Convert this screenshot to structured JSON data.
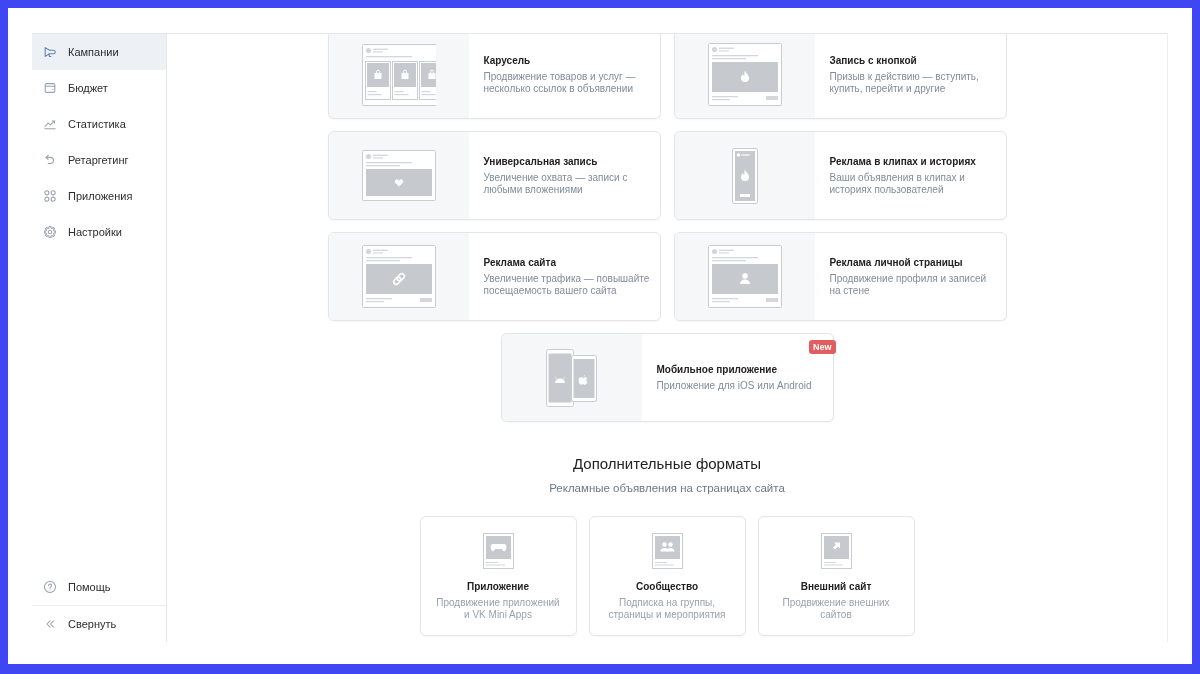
{
  "sidebar": {
    "items": [
      {
        "label": "Кампании",
        "selected": true
      },
      {
        "label": "Бюджет",
        "selected": false
      },
      {
        "label": "Статистика",
        "selected": false
      },
      {
        "label": "Ретаргетинг",
        "selected": false
      },
      {
        "label": "Приложения",
        "selected": false
      },
      {
        "label": "Настройки",
        "selected": false
      }
    ],
    "footer_items": [
      {
        "label": "Помощь"
      },
      {
        "label": "Свернуть"
      }
    ]
  },
  "formats": [
    {
      "kind": "carousel",
      "title": "Карусель",
      "description": "Продвижение товаров и услуг — несколько ссылок в объявлении"
    },
    {
      "kind": "button_post",
      "title": "Запись с кнопкой",
      "description": "Призыв к действию — вступить, купить, перейти и другие"
    },
    {
      "kind": "universal",
      "title": "Универсальная запись",
      "description": "Увеличение охвата — записи с любыми вложениями"
    },
    {
      "kind": "clips",
      "title": "Реклама в клипах и историях",
      "description": "Ваши объявления в клипах и историях пользователей"
    },
    {
      "kind": "site",
      "title": "Реклама сайта",
      "description": "Увеличение трафика — повышайте посещаемость вашего сайта"
    },
    {
      "kind": "profile",
      "title": "Реклама личной страницы",
      "description": "Продвижение профиля и записей на стене"
    },
    {
      "kind": "mobile",
      "title": "Мобильное приложение",
      "description": "Приложение для iOS или Android",
      "badge": "New"
    }
  ],
  "additional_formats": {
    "title": "Дополнительные форматы",
    "subtitle": "Рекламные объявления на страницах сайта",
    "items": [
      {
        "kind": "app",
        "title": "Приложение",
        "description": "Продвижение приложений и VK Mini Apps"
      },
      {
        "kind": "community",
        "title": "Сообщество",
        "description": "Подписка на группы, страницы и мероприятия"
      },
      {
        "kind": "external",
        "title": "Внешний сайт",
        "description": "Продвижение внешних сайтов"
      }
    ]
  }
}
